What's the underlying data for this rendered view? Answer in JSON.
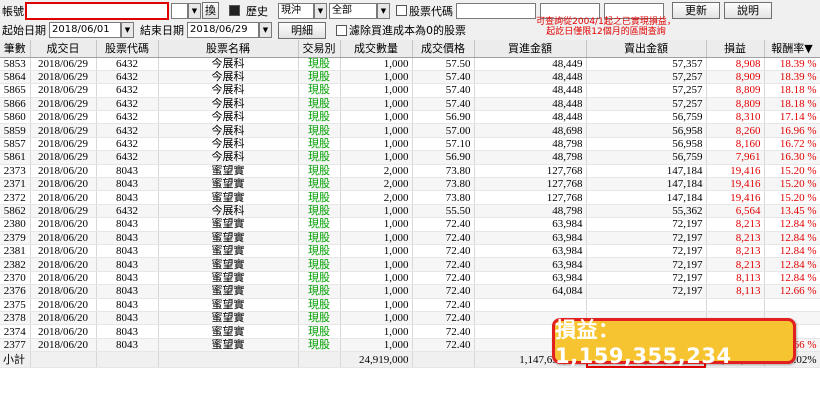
{
  "toolbar": {
    "account_label": "帳號",
    "account_value": "",
    "switch_btn": "換",
    "history_label": "歷史",
    "trade_type_value": "現沖",
    "category_value": "全部",
    "stock_code_label": "股票代碼",
    "stock_code_value": "",
    "update_btn": "更新",
    "help_btn": "說明",
    "start_date_label": "起始日期",
    "start_date_value": "2018/06/01",
    "end_date_label": "結束日期",
    "end_date_value": "2018/06/29",
    "detail_btn": "明細",
    "exclude_zero_label": "濾除買進成本為0的股票",
    "notice_line1": "可查詢從2004/1起之已實現損益，",
    "notice_line2": "起訖日僅限12個月的區間查詢"
  },
  "table": {
    "headers": [
      "筆數",
      "成交日",
      "股票代碼",
      "股票名稱",
      "交易別",
      "成交數量",
      "成交價格",
      "買進金額",
      "賣出金額",
      "損益",
      "報酬率▼"
    ],
    "rows": [
      [
        "5853",
        "2018/06/29",
        "6432",
        "今展科",
        "現股",
        "1,000",
        "57.50",
        "48,449",
        "57,357",
        "8,908",
        "18.39 %"
      ],
      [
        "5864",
        "2018/06/29",
        "6432",
        "今展科",
        "現股",
        "1,000",
        "57.40",
        "48,448",
        "57,257",
        "8,909",
        "18.39 %"
      ],
      [
        "5865",
        "2018/06/29",
        "6432",
        "今展科",
        "現股",
        "1,000",
        "57.40",
        "48,448",
        "57,257",
        "8,809",
        "18.18 %"
      ],
      [
        "5866",
        "2018/06/29",
        "6432",
        "今展科",
        "現股",
        "1,000",
        "57.40",
        "48,448",
        "57,257",
        "8,809",
        "18.18 %"
      ],
      [
        "5860",
        "2018/06/29",
        "6432",
        "今展科",
        "現股",
        "1,000",
        "56.90",
        "48,448",
        "56,759",
        "8,310",
        "17.14 %"
      ],
      [
        "5859",
        "2018/06/29",
        "6432",
        "今展科",
        "現股",
        "1,000",
        "57.00",
        "48,698",
        "56,958",
        "8,260",
        "16.96 %"
      ],
      [
        "5857",
        "2018/06/29",
        "6432",
        "今展科",
        "現股",
        "1,000",
        "57.10",
        "48,798",
        "56,958",
        "8,160",
        "16.72 %"
      ],
      [
        "5861",
        "2018/06/29",
        "6432",
        "今展科",
        "現股",
        "1,000",
        "56.90",
        "48,798",
        "56,759",
        "7,961",
        "16.30 %"
      ],
      [
        "2373",
        "2018/06/20",
        "8043",
        "蜜望實",
        "現股",
        "2,000",
        "73.80",
        "127,768",
        "147,184",
        "19,416",
        "15.20 %"
      ],
      [
        "2371",
        "2018/06/20",
        "8043",
        "蜜望實",
        "現股",
        "2,000",
        "73.80",
        "127,768",
        "147,184",
        "19,416",
        "15.20 %"
      ],
      [
        "2372",
        "2018/06/20",
        "8043",
        "蜜望實",
        "現股",
        "2,000",
        "73.80",
        "127,768",
        "147,184",
        "19,416",
        "15.20 %"
      ],
      [
        "5862",
        "2018/06/29",
        "6432",
        "今展科",
        "現股",
        "1,000",
        "55.50",
        "48,798",
        "55,362",
        "6,564",
        "13.45 %"
      ],
      [
        "2380",
        "2018/06/20",
        "8043",
        "蜜望實",
        "現股",
        "1,000",
        "72.40",
        "63,984",
        "72,197",
        "8,213",
        "12.84 %"
      ],
      [
        "2379",
        "2018/06/20",
        "8043",
        "蜜望實",
        "現股",
        "1,000",
        "72.40",
        "63,984",
        "72,197",
        "8,213",
        "12.84 %"
      ],
      [
        "2381",
        "2018/06/20",
        "8043",
        "蜜望實",
        "現股",
        "1,000",
        "72.40",
        "63,984",
        "72,197",
        "8,213",
        "12.84 %"
      ],
      [
        "2382",
        "2018/06/20",
        "8043",
        "蜜望實",
        "現股",
        "1,000",
        "72.40",
        "63,984",
        "72,197",
        "8,213",
        "12.84 %"
      ],
      [
        "2370",
        "2018/06/20",
        "8043",
        "蜜望實",
        "現股",
        "1,000",
        "72.40",
        "63,984",
        "72,197",
        "8,113",
        "12.84 %"
      ],
      [
        "2376",
        "2018/06/20",
        "8043",
        "蜜望實",
        "現股",
        "1,000",
        "72.40",
        "64,084",
        "72,197",
        "8,113",
        "12.66 %"
      ],
      [
        "2375",
        "2018/06/20",
        "8043",
        "蜜望實",
        "現股",
        "1,000",
        "72.40",
        "",
        "",
        "",
        ""
      ],
      [
        "2378",
        "2018/06/20",
        "8043",
        "蜜望實",
        "現股",
        "1,000",
        "72.40",
        "",
        "",
        "",
        ""
      ],
      [
        "2374",
        "2018/06/20",
        "8043",
        "蜜望實",
        "現股",
        "1,000",
        "72.40",
        "",
        "",
        "",
        ""
      ],
      [
        "2377",
        "2018/06/20",
        "8043",
        "蜜望實",
        "現股",
        "1,000",
        "72.40",
        "64,084",
        "72,197",
        "8,113",
        "12.66 %"
      ]
    ],
    "subtotal": {
      "label": "小計",
      "qty": "24,919,000",
      "buy": "1,147,693,316",
      "sell": "1,159,355,234",
      "pnl": "11,661,918",
      "rate": "1.02%"
    }
  },
  "callout_text": "損益：1,159,355,234",
  "colors": {
    "profit_red": "#e00000",
    "stock_green": "#00a000",
    "callout_bg": "#f7c431",
    "callout_border": "#e32020"
  }
}
